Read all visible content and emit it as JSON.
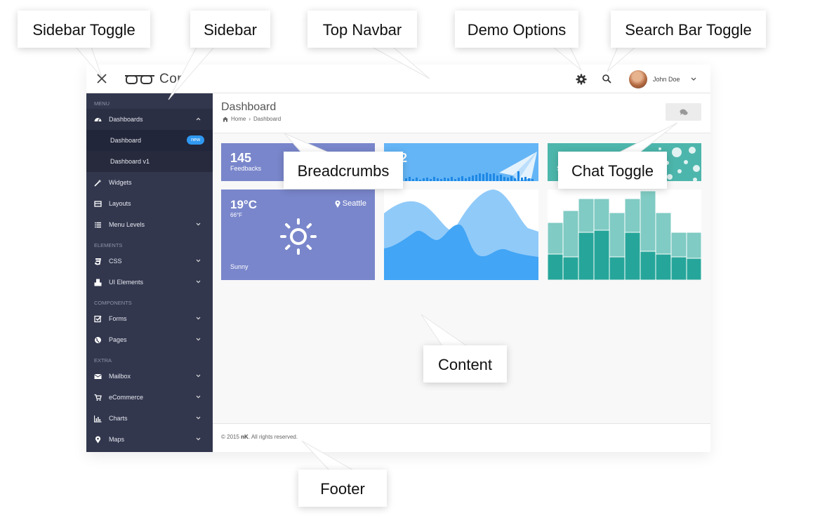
{
  "callouts": {
    "sidebar_toggle": "Sidebar Toggle",
    "sidebar": "Sidebar",
    "top_navbar": "Top Navbar",
    "demo_options": "Demo Options",
    "search_bar_toggle": "Search Bar Toggle",
    "breadcrumbs": "Breadcrumbs",
    "chat_toggle": "Chat Toggle",
    "content": "Content",
    "footer": "Footer"
  },
  "navbar": {
    "logo_text": "Cor",
    "user_name": "John Doe"
  },
  "sidebar": {
    "sections": [
      {
        "heading": "MENU"
      },
      {
        "heading": "ELEMENTS"
      },
      {
        "heading": "COMPONENTS"
      },
      {
        "heading": "EXTRA"
      }
    ],
    "items": {
      "dashboards": "Dashboards",
      "dashboard": "Dashboard",
      "dashboard_badge": "new",
      "dashboard_v1": "Dashboard v1",
      "widgets": "Widgets",
      "layouts": "Layouts",
      "menu_levels": "Menu Levels",
      "css": "CSS",
      "ui_elements": "UI Elements",
      "forms": "Forms",
      "pages": "Pages",
      "mailbox": "Mailbox",
      "ecommerce": "eCommerce",
      "charts": "Charts",
      "maps": "Maps"
    }
  },
  "page": {
    "title": "Dashboard",
    "breadcrumb": [
      "Home",
      "Dashboard"
    ]
  },
  "cards": {
    "feedbacks": {
      "value": "145",
      "label": "Feedbacks"
    },
    "second": {
      "value": "42",
      "label": "ts"
    },
    "third": {
      "value": "",
      "label": "S"
    }
  },
  "weather": {
    "temp_c": "19°C",
    "temp_f": "66°F",
    "city": "Seattle",
    "condition": "Sunny"
  },
  "colors": {
    "sidebar_bg": "#32374e",
    "card_indigo": "#7986cb",
    "card_blue": "#64b5f6",
    "card_teal": "#4db6ac",
    "badge_blue": "#2f98f0"
  },
  "footer": {
    "year_text": "© 2015",
    "brand": "nK",
    "rights": ". All rights reserved."
  },
  "icons": [
    "close-icon",
    "glasses-logo-icon",
    "gear-icon",
    "search-icon",
    "chevron-down-icon",
    "chat-icon",
    "home-icon",
    "map-marker-icon",
    "sun-icon"
  ]
}
